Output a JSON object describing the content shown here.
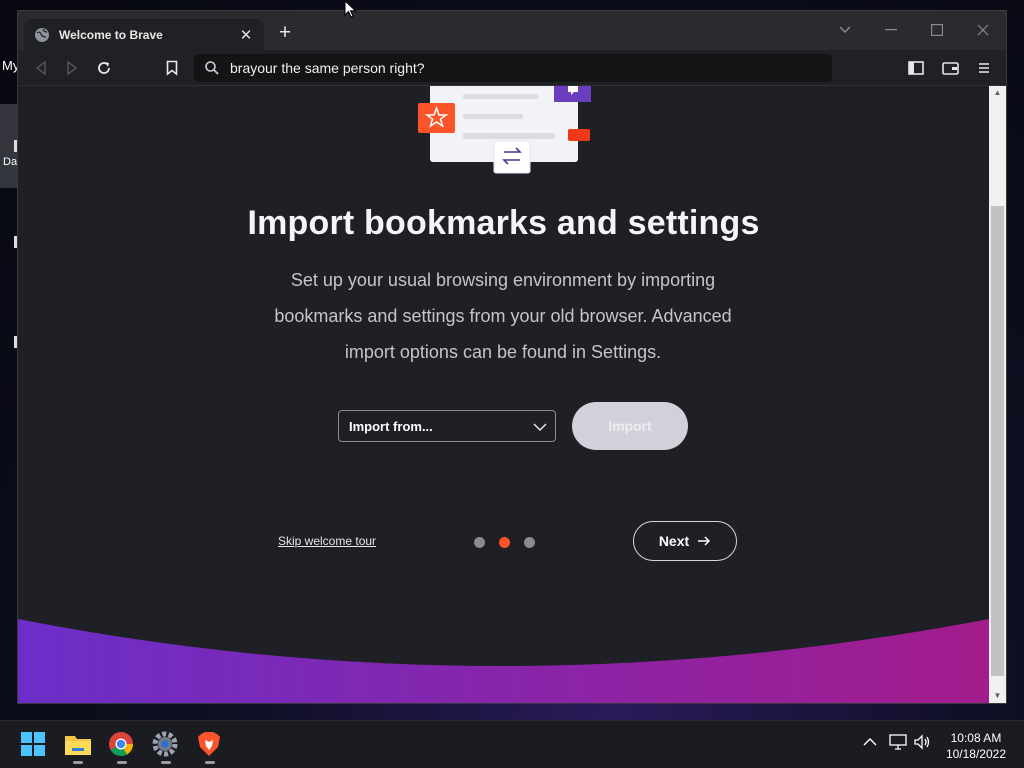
{
  "desktop": {
    "icon_label_1": "My",
    "icon_label_2": "Da"
  },
  "browser": {
    "tab_title": "Welcome to Brave",
    "address_value": "brayour the same person right?"
  },
  "page": {
    "heading": "Import bookmarks and settings",
    "description": "Set up your usual browsing environment by importing bookmarks and settings from your old browser. Advanced import options can be found in Settings.",
    "import_select_value": "Import from...",
    "import_button_label": "Import",
    "skip_link": "Skip welcome tour",
    "next_button_label": "Next",
    "step_dots": {
      "total": 3,
      "active": 2
    }
  },
  "colors": {
    "accent_orange": "#fb542b",
    "dot_inactive": "#8a8a92",
    "wave_start": "#6b2ec8",
    "wave_end": "#a31c8c"
  },
  "taskbar": {
    "apps": [
      "windows-start",
      "file-explorer",
      "google-chrome",
      "settings",
      "brave-browser"
    ],
    "time": "10:08 AM",
    "date": "10/18/2022"
  }
}
